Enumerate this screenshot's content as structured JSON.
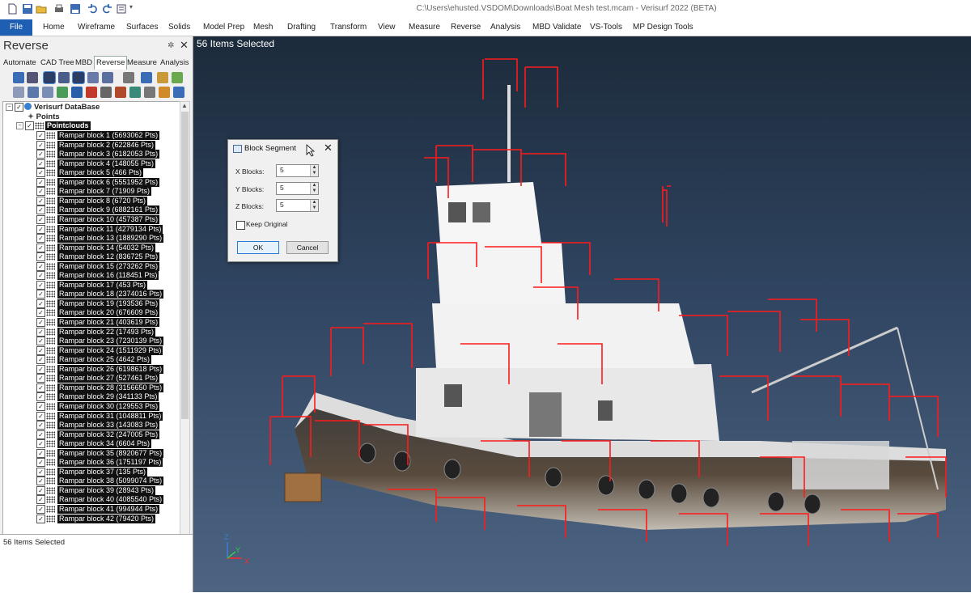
{
  "titlebar": {
    "title": "C:\\Users\\ehusted.VSDOM\\Downloads\\Boat Mesh test.mcam - Verisurf 2022 (BETA)"
  },
  "ribbon": {
    "tabs": [
      "File",
      "Home",
      "Wireframe",
      "Surfaces",
      "Solids",
      "Model Prep",
      "Mesh",
      "Drafting",
      "Transform",
      "View",
      "Measure",
      "Reverse",
      "Analysis",
      "MBD Validate",
      "VS-Tools",
      "MP Design Tools"
    ]
  },
  "panel": {
    "title": "Reverse",
    "pin": "✲",
    "close": "✕",
    "tabs": [
      "Automate",
      "CAD Tree",
      "MBD",
      "Reverse",
      "Measure",
      "Analysis"
    ],
    "active_tab": "Reverse",
    "tree": {
      "root": "Verisurf DataBase",
      "points": "Points",
      "pointclouds": "Pointclouds",
      "items": [
        "Rampar block 1 (5693062 Pts)",
        "Rampar block 2 (622846 Pts)",
        "Rampar block 3 (6182053 Pts)",
        "Rampar block 4 (148055 Pts)",
        "Rampar block 5 (466 Pts)",
        "Rampar block 6 (5551952 Pts)",
        "Rampar block 7 (71909 Pts)",
        "Rampar block 8 (6720 Pts)",
        "Rampar block 9 (6882161 Pts)",
        "Rampar block 10 (457387 Pts)",
        "Rampar block 11 (4279134 Pts)",
        "Rampar block 13 (1889290 Pts)",
        "Rampar block 14 (54032 Pts)",
        "Rampar block 12 (836725 Pts)",
        "Rampar block 15 (273262 Pts)",
        "Rampar block 16 (118451 Pts)",
        "Rampar block 17 (453 Pts)",
        "Rampar block 18 (2374016 Pts)",
        "Rampar block 19 (193536 Pts)",
        "Rampar block 20 (676609 Pts)",
        "Rampar block 21 (403619 Pts)",
        "Rampar block 22 (17493 Pts)",
        "Rampar block 23 (7230139 Pts)",
        "Rampar block 24 (1511929 Pts)",
        "Rampar block 25 (4642 Pts)",
        "Rampar block 26 (6198618 Pts)",
        "Rampar block 27 (527461 Pts)",
        "Rampar block 28 (3156650 Pts)",
        "Rampar block 29 (341133 Pts)",
        "Rampar block 30 (129553 Pts)",
        "Rampar block 31 (1048811 Pts)",
        "Rampar block 33 (143083 Pts)",
        "Rampar block 32 (247005 Pts)",
        "Rampar block 34 (6604 Pts)",
        "Rampar block 35 (8920677 Pts)",
        "Rampar block 36 (1751197 Pts)",
        "Rampar block 37 (135 Pts)",
        "Rampar block 38 (5099074 Pts)",
        "Rampar block 39 (28943 Pts)",
        "Rampar block 40 (4085540 Pts)",
        "Rampar block 41 (994944 Pts)",
        "Rampar block 42 (79420 Pts)"
      ]
    },
    "status": "56 Items Selected"
  },
  "viewport": {
    "label": "56 Items Selected",
    "axes": {
      "x": "X",
      "y": "Y",
      "z": "Z"
    },
    "colors": {
      "bbox": "#ff1a1a",
      "bg_top": "#1c2b3b",
      "bg_bottom": "#4c6482"
    }
  },
  "dialog": {
    "title": "Block Segment",
    "close": "✕",
    "x_label": "X Blocks:",
    "x_value": "5",
    "y_label": "Y Blocks:",
    "y_value": "5",
    "z_label": "Z Blocks:",
    "z_value": "5",
    "keep_original": "Keep Original",
    "keep_original_checked": false,
    "ok": "OK",
    "cancel": "Cancel"
  }
}
